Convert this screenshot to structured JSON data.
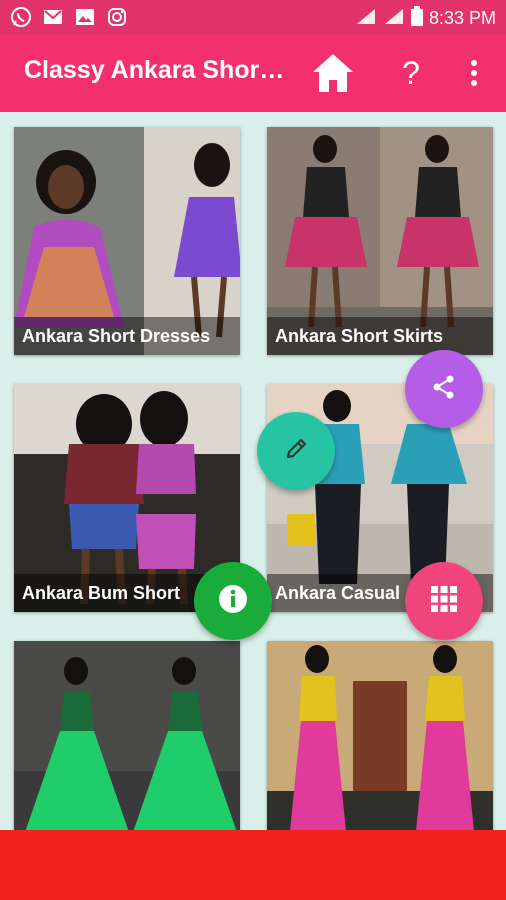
{
  "status_bar": {
    "icons": [
      "whatsapp-icon",
      "gmail-icon",
      "gallery-icon",
      "instagram-icon"
    ],
    "time": "8:33 PM",
    "right_icons": [
      "signal-icon",
      "signal-icon",
      "battery-icon"
    ]
  },
  "app_bar": {
    "title": "Classy Ankara Short Dresses",
    "icons": [
      "home-icon",
      "help-icon",
      "more-vert-icon"
    ],
    "help_label": "?"
  },
  "grid": {
    "items": [
      {
        "label": "Ankara Short Dresses"
      },
      {
        "label": "Ankara Short Skirts"
      },
      {
        "label": "Ankara Bum Short"
      },
      {
        "label": "Ankara Casual"
      },
      {
        "label": ""
      },
      {
        "label": ""
      }
    ]
  },
  "fabs": [
    {
      "name": "share-icon",
      "color": "#b45ee8"
    },
    {
      "name": "edit-icon",
      "color": "#27c4a3"
    },
    {
      "name": "info-icon",
      "color": "#1aac3a"
    },
    {
      "name": "apps-grid-icon",
      "color": "#f0457c"
    }
  ],
  "colors": {
    "status_bar": "#e3336c",
    "app_bar": "#f2306e",
    "background": "#d9efe9",
    "bottom_bar": "#f4221f"
  }
}
